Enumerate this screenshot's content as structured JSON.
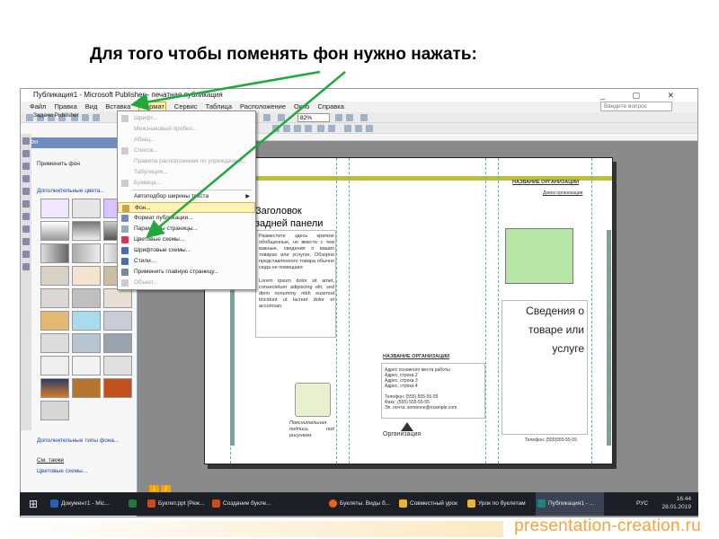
{
  "slide": {
    "title": "Для того чтобы поменять фон нужно нажать:"
  },
  "window": {
    "title": "Публикация1 - Microsoft Publisher - печатная публикация"
  },
  "menubar": {
    "items": [
      "Файл",
      "Правка",
      "Вид",
      "Вставка",
      "Формат",
      "Сервис",
      "Таблица",
      "Расположение",
      "Окно",
      "Справка"
    ],
    "help_placeholder": "Введите вопрос",
    "zoom": "82%"
  },
  "task_pane": {
    "title": "Фон",
    "heading": "Применить фон",
    "more_colors": "Дополнительные цвета...",
    "more_types": "Дополнительные типы фона...",
    "see_also": "См. также",
    "color_schemes": "Цветовые схемы...",
    "toolbar_label": "Задачи Publisher"
  },
  "format_menu": {
    "items": [
      {
        "label": "Шрифт...",
        "disabled": true
      },
      {
        "label": "Межзнаковый пробел...",
        "disabled": true
      },
      {
        "label": "Абзац...",
        "disabled": true
      },
      {
        "label": "Список...",
        "disabled": true
      },
      {
        "label": "Правила расположения по упреждению...",
        "disabled": true
      },
      {
        "label": "Табуляция...",
        "disabled": true
      },
      {
        "label": "Буквица...",
        "disabled": true
      },
      {
        "label": "Автоподбор ширины текста",
        "disabled": false,
        "submenu": true
      },
      {
        "label": "Фон...",
        "disabled": false,
        "highlighted": true
      },
      {
        "label": "Формат публикации...",
        "disabled": false
      },
      {
        "label": "Параметры страницы...",
        "disabled": false
      },
      {
        "label": "Цветовые схемы...",
        "disabled": false
      },
      {
        "label": "Шрифтовые схемы...",
        "disabled": false
      },
      {
        "label": "Стили...",
        "disabled": false
      },
      {
        "label": "Применить главную страницу...",
        "disabled": false
      },
      {
        "label": "Объект...",
        "disabled": true
      }
    ]
  },
  "publication": {
    "panel_heading": "Заголовок задней панели",
    "body_text": "Разместите здесь краткое обобщенные, но вместе с тем важные, сведения о ваших товарах или услугах. Обзорно представленного товара обычно сюда не помещают.",
    "lorem": "Lorem ipsum dolor sit amet, consectetuer adipiscing elit, sed diem nonummy nibh euismod tincidunt ut lacreet dolor et accumsan.",
    "caption": "Пояснительная подпись под рисунком.",
    "org_name": "НАЗВАНИЕ ОРГАНИЗАЦИИ",
    "org_name_right": "НАЗВАНИЕ ОРГАНИЗАЦИИ",
    "org_sub": "Девиз организации",
    "org_addr_lines": [
      "Адрес основного места работы",
      "Адрес, строка 2",
      "Адрес, строка 3",
      "Адрес, строка 4"
    ],
    "phone_lines": [
      "Телефон: (555) 555-55-55",
      "Факс: (555) 555-55-55",
      "Эл. почта: someone@example.com"
    ],
    "logo_text": "Организация",
    "info_title": "Сведения о товаре или услуге",
    "phone": "Телефон: (555)555-55-55"
  },
  "page_tabs": [
    "1",
    "2"
  ],
  "taskbar": {
    "items": [
      "Документ1 - Mic...",
      "Буклет.ppt [Реж...",
      "Создание букле...",
      "Буклеты. Виды б...",
      "Совместный урок",
      "Урок по буклетам",
      "Публикация1 - ..."
    ],
    "lang": "РУС",
    "time": "16:44",
    "date": "28.01.2019"
  },
  "watermark": "presentation-creation.ru",
  "colors": {
    "arrow": "#1fa83b",
    "menu_highlight": "#fff2b5",
    "accent_olive": "#bdbe3a",
    "watermark": "#f5a43b"
  }
}
